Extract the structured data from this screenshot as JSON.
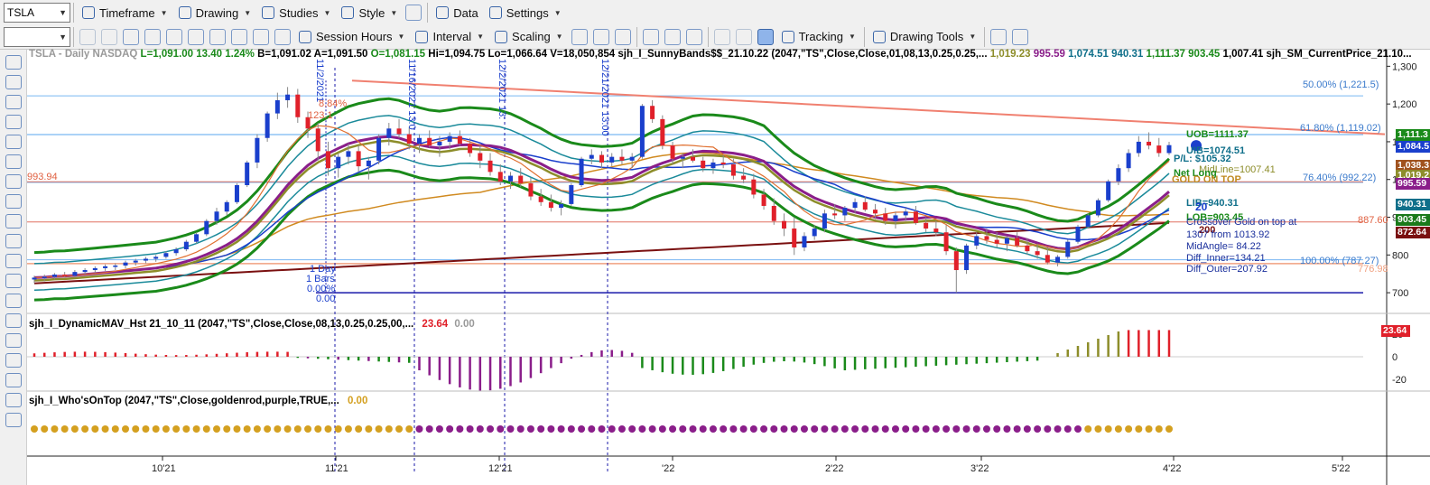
{
  "toolbar1": {
    "symbol": "TSLA",
    "timeframe": "Timeframe",
    "drawing": "Drawing",
    "studies": "Studies",
    "style": "Style",
    "data": "Data",
    "settings": "Settings"
  },
  "toolbar2": {
    "session_hours": "Session Hours",
    "interval": "Interval",
    "scaling": "Scaling",
    "tracking": "Tracking",
    "drawing_tools": "Drawing Tools"
  },
  "header": {
    "symbol_label": "TSLA - Daily NASDAQ",
    "last": "L=1,091.00",
    "chg": "13.40",
    "chg_pct": "1.24%",
    "bid": "B=1,091.02",
    "ask": "A=1,091.50",
    "open": "O=1,081.15",
    "high": "Hi=1,094.75",
    "low": "Lo=1,066.64",
    "volume": "V=18,050,854",
    "study": "sjh_I_SunnyBands$$_21.10.22 (2047,\"TS\",Close,Close,01,08,13,0.25,0.25,...",
    "v1": "1,019.23",
    "v2": "995.59",
    "v3": "1,074.51",
    "v4": "940.31",
    "v5": "1,111.37",
    "v6": "903.45",
    "v7": "1,007.41",
    "study2": "sjh_SM_CurrentPrice_21.10..."
  },
  "sub1": {
    "title": "sjh_I_DynamicMAV_Hst 21_10_11 (2047,\"TS\",Close,Close,08,13,0.25,0.25,00,...",
    "val1": "23.64",
    "val2": "0.00",
    "tag": "23.64"
  },
  "sub2": {
    "title": "sjh_I_Who'sOnTop (2047,\"TS\",Close,goldenrod,purple,TRUE,...",
    "val": "0.00"
  },
  "annotations": {
    "level_993": "993.94",
    "fib50": "50.00% (1,221.5)",
    "fib618": "61.80% (1,119.02)",
    "fib764": "76.40% (992.22)",
    "fib100": "100.00% (787.27)",
    "level_887": "887.60",
    "level_776": "776.98",
    "uob": "UOB=1111.37",
    "uib": "UIB=1074.51",
    "pl": "P/L: $105.32",
    "midline": "MidLine=1007.41",
    "net": "Net Long",
    "gold": "GOLD ON TOP",
    "lib": "LIB=940.31",
    "lob": "LOB=903.45",
    "cross1": "Crossover Gold on top at",
    "cross2": "1307 from 1013.92",
    "midangle": "MidAngle= 84.22",
    "diff_inner": "Diff_Inner=134.21",
    "diff_outer": "Diff_Outer=207.92",
    "n20": "20",
    "n200": "200",
    "bars1": "1 Day",
    "bars2": "1 Bars",
    "bars3": "0.00%",
    "bars4": "0.00",
    "v_a": "8.84%",
    "v_b": "123.1",
    "d1": "11/2/2021",
    "d2": "11/16/2021 13:0",
    "d3": "12/2/2021 13:",
    "d4": "12/21/2021 13:00"
  },
  "price_tags": [
    {
      "text": "1,111.3",
      "color": "#1a8a1a"
    },
    {
      "text": "1,084.5",
      "color": "#1a3fcc"
    },
    {
      "text": "1,038.3",
      "color": "#a0521e"
    },
    {
      "text": "1,019.2",
      "color": "#8d8d2a"
    },
    {
      "text": "995.59",
      "color": "#8a1e8a"
    },
    {
      "text": "940.31",
      "color": "#0f6f8a"
    },
    {
      "text": "903.45",
      "color": "#1a7a1a"
    },
    {
      "text": "872.64",
      "color": "#7a1010"
    }
  ],
  "chart_data": {
    "type": "candlestick",
    "symbol": "TSLA",
    "interval": "Daily",
    "y_axis": {
      "ticks": [
        700,
        800,
        900,
        1000,
        1100,
        1200,
        1300
      ],
      "ylim": [
        650,
        1320
      ]
    },
    "x_ticks": [
      "10'21",
      "11'21",
      "12'21",
      "'22",
      "2'22",
      "3'22",
      "4'22",
      "5'22"
    ],
    "candles_approx": [
      [
        735,
        745,
        725,
        740
      ],
      [
        740,
        748,
        730,
        742
      ],
      [
        742,
        752,
        735,
        748
      ],
      [
        748,
        755,
        740,
        745
      ],
      [
        745,
        760,
        740,
        755
      ],
      [
        755,
        765,
        748,
        760
      ],
      [
        760,
        770,
        752,
        765
      ],
      [
        765,
        775,
        758,
        770
      ],
      [
        770,
        778,
        760,
        772
      ],
      [
        772,
        785,
        765,
        780
      ],
      [
        780,
        790,
        772,
        785
      ],
      [
        785,
        795,
        778,
        790
      ],
      [
        790,
        800,
        782,
        795
      ],
      [
        795,
        810,
        790,
        805
      ],
      [
        805,
        820,
        798,
        815
      ],
      [
        815,
        840,
        810,
        835
      ],
      [
        835,
        860,
        830,
        855
      ],
      [
        855,
        895,
        850,
        890
      ],
      [
        890,
        925,
        880,
        915
      ],
      [
        915,
        945,
        905,
        940
      ],
      [
        940,
        990,
        935,
        985
      ],
      [
        985,
        1050,
        980,
        1045
      ],
      [
        1045,
        1120,
        1030,
        1110
      ],
      [
        1110,
        1180,
        1100,
        1175
      ],
      [
        1175,
        1230,
        1160,
        1210
      ],
      [
        1210,
        1245,
        1190,
        1225
      ],
      [
        1225,
        1240,
        1150,
        1165
      ],
      [
        1165,
        1180,
        1110,
        1135
      ],
      [
        1135,
        1150,
        1050,
        1075
      ],
      [
        1075,
        1100,
        1010,
        1030
      ],
      [
        1030,
        1070,
        1005,
        1060
      ],
      [
        1060,
        1095,
        1040,
        1075
      ],
      [
        1075,
        1090,
        1020,
        1035
      ],
      [
        1035,
        1060,
        1000,
        1050
      ],
      [
        1050,
        1120,
        1040,
        1110
      ],
      [
        1110,
        1150,
        1090,
        1135
      ],
      [
        1135,
        1160,
        1110,
        1120
      ],
      [
        1120,
        1140,
        1080,
        1095
      ],
      [
        1095,
        1120,
        1070,
        1110
      ],
      [
        1110,
        1130,
        1085,
        1090
      ],
      [
        1090,
        1115,
        1060,
        1100
      ],
      [
        1100,
        1125,
        1080,
        1115
      ],
      [
        1115,
        1130,
        1090,
        1095
      ],
      [
        1095,
        1110,
        1060,
        1070
      ],
      [
        1070,
        1090,
        1030,
        1050
      ],
      [
        1050,
        1070,
        1010,
        1020
      ],
      [
        1020,
        1040,
        985,
        995
      ],
      [
        995,
        1020,
        975,
        1010
      ],
      [
        1010,
        1030,
        980,
        990
      ],
      [
        990,
        1005,
        945,
        955
      ],
      [
        955,
        975,
        930,
        940
      ],
      [
        940,
        960,
        915,
        925
      ],
      [
        925,
        945,
        905,
        935
      ],
      [
        935,
        990,
        930,
        985
      ],
      [
        985,
        1060,
        980,
        1055
      ],
      [
        1055,
        1080,
        1040,
        1065
      ],
      [
        1065,
        1075,
        1030,
        1045
      ],
      [
        1045,
        1070,
        1035,
        1060
      ],
      [
        1060,
        1080,
        1040,
        1050
      ],
      [
        1050,
        1070,
        1030,
        1060
      ],
      [
        1060,
        1200,
        1055,
        1195
      ],
      [
        1195,
        1210,
        1150,
        1160
      ],
      [
        1160,
        1170,
        1080,
        1090
      ],
      [
        1090,
        1100,
        1040,
        1055
      ],
      [
        1055,
        1070,
        1030,
        1060
      ],
      [
        1060,
        1080,
        1045,
        1050
      ],
      [
        1050,
        1060,
        1020,
        1030
      ],
      [
        1030,
        1055,
        1015,
        1045
      ],
      [
        1045,
        1065,
        1030,
        1040
      ],
      [
        1040,
        1055,
        1000,
        1010
      ],
      [
        1010,
        1030,
        990,
        1000
      ],
      [
        1000,
        1015,
        950,
        960
      ],
      [
        960,
        975,
        920,
        930
      ],
      [
        930,
        950,
        880,
        890
      ],
      [
        890,
        910,
        850,
        870
      ],
      [
        870,
        900,
        800,
        820
      ],
      [
        820,
        860,
        810,
        850
      ],
      [
        850,
        880,
        840,
        870
      ],
      [
        870,
        920,
        860,
        910
      ],
      [
        910,
        935,
        895,
        905
      ],
      [
        905,
        930,
        890,
        925
      ],
      [
        925,
        950,
        910,
        940
      ],
      [
        940,
        955,
        915,
        920
      ],
      [
        920,
        935,
        895,
        910
      ],
      [
        910,
        925,
        880,
        890
      ],
      [
        890,
        915,
        870,
        905
      ],
      [
        905,
        925,
        890,
        915
      ],
      [
        915,
        930,
        880,
        885
      ],
      [
        885,
        900,
        860,
        870
      ],
      [
        870,
        890,
        850,
        860
      ],
      [
        860,
        880,
        800,
        810
      ],
      [
        810,
        820,
        700,
        760
      ],
      [
        760,
        830,
        750,
        825
      ],
      [
        825,
        860,
        815,
        850
      ],
      [
        850,
        870,
        830,
        840
      ],
      [
        840,
        860,
        820,
        830
      ],
      [
        830,
        850,
        810,
        845
      ],
      [
        845,
        860,
        820,
        825
      ],
      [
        825,
        845,
        800,
        810
      ],
      [
        810,
        830,
        790,
        800
      ],
      [
        800,
        820,
        775,
        780
      ],
      [
        780,
        800,
        770,
        795
      ],
      [
        795,
        840,
        790,
        835
      ],
      [
        835,
        880,
        830,
        875
      ],
      [
        875,
        910,
        870,
        905
      ],
      [
        905,
        950,
        900,
        945
      ],
      [
        945,
        1000,
        940,
        995
      ],
      [
        995,
        1040,
        985,
        1030
      ],
      [
        1030,
        1080,
        1020,
        1070
      ],
      [
        1070,
        1115,
        1060,
        1100
      ],
      [
        1100,
        1125,
        1080,
        1090
      ],
      [
        1090,
        1110,
        1060,
        1070
      ],
      [
        1070,
        1100,
        1065,
        1091
      ]
    ]
  }
}
